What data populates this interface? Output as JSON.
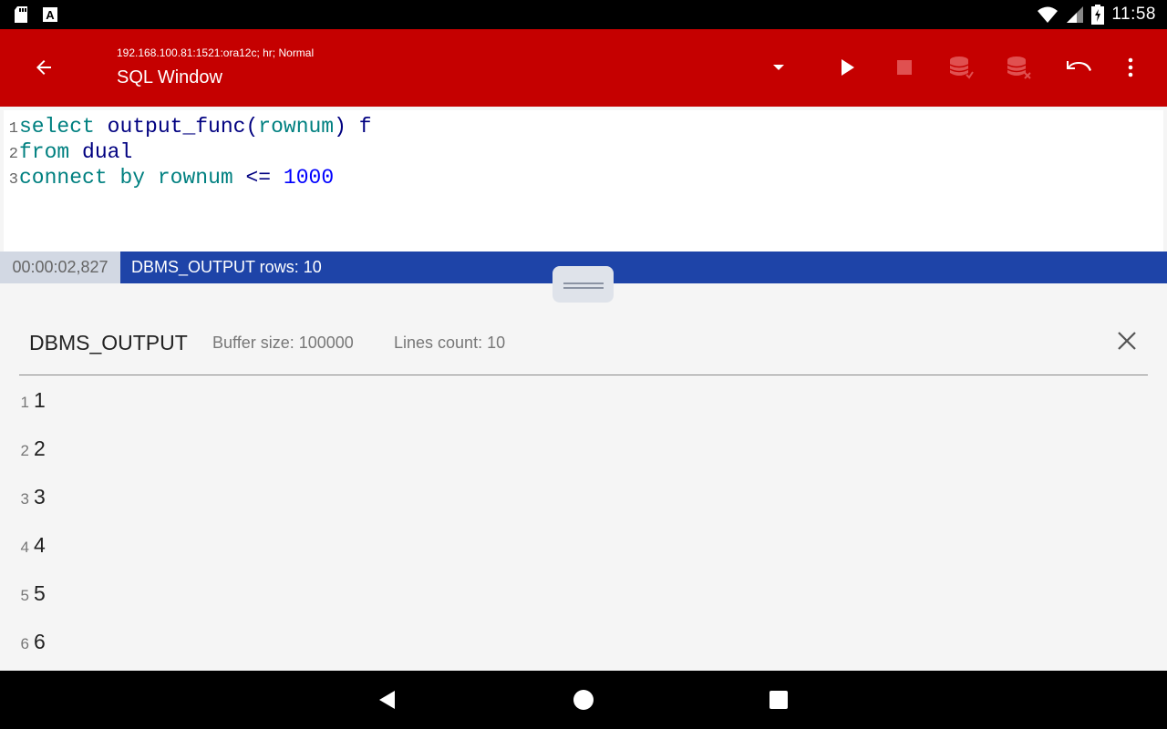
{
  "status_bar": {
    "time": "11:58",
    "left_icons": [
      "sd-card-icon",
      "a-box-icon"
    ],
    "right_icons": [
      "wifi-icon",
      "signal-icon",
      "battery-icon"
    ]
  },
  "app_bar": {
    "subtitle": "192.168.100.81:1521:ora12c; hr; Normal",
    "title": "SQL Window",
    "actions": [
      "dropdown-icon",
      "run-icon",
      "stop-icon",
      "commit-icon",
      "rollback-icon",
      "undo-icon",
      "more-vert-icon"
    ],
    "colors": {
      "bar": "#c50000"
    }
  },
  "editor": {
    "lines": [
      {
        "num": "1",
        "tokens": [
          {
            "t": "select",
            "c": "kw"
          },
          {
            "t": " ",
            "c": ""
          },
          {
            "t": "output_func(",
            "c": "id"
          },
          {
            "t": "rownum",
            "c": "kw"
          },
          {
            "t": ") f",
            "c": "id"
          }
        ]
      },
      {
        "num": "2",
        "tokens": [
          {
            "t": "from",
            "c": "kw"
          },
          {
            "t": " ",
            "c": ""
          },
          {
            "t": "dual",
            "c": "id"
          }
        ]
      },
      {
        "num": "3",
        "tokens": [
          {
            "t": "connect",
            "c": "kw"
          },
          {
            "t": " ",
            "c": ""
          },
          {
            "t": "by",
            "c": "kw"
          },
          {
            "t": " ",
            "c": ""
          },
          {
            "t": "rownum",
            "c": "kw"
          },
          {
            "t": " <= ",
            "c": "op"
          },
          {
            "t": "1000",
            "c": "num"
          }
        ]
      }
    ]
  },
  "info_bar": {
    "elapsed": "00:00:02,827",
    "rows_label": "DBMS_OUTPUT rows: 10"
  },
  "output": {
    "title": "DBMS_OUTPUT",
    "buffer": "Buffer size: 100000",
    "lines_count": "Lines count: 10",
    "rows": [
      {
        "num": "1",
        "value": "1"
      },
      {
        "num": "2",
        "value": "2"
      },
      {
        "num": "3",
        "value": "3"
      },
      {
        "num": "4",
        "value": "4"
      },
      {
        "num": "5",
        "value": "5"
      },
      {
        "num": "6",
        "value": "6"
      }
    ]
  }
}
